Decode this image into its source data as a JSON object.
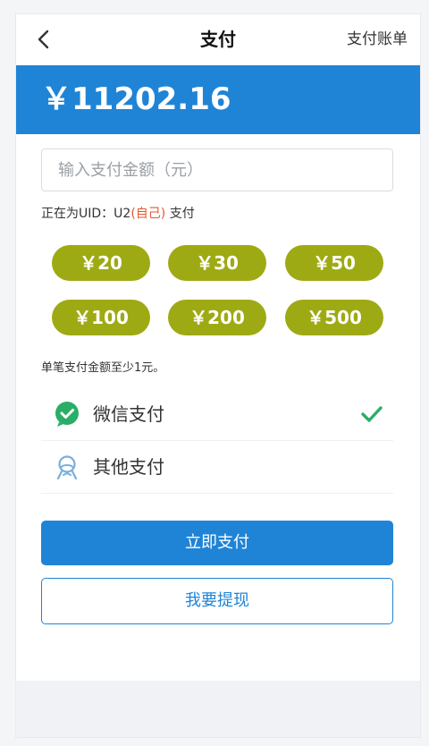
{
  "header": {
    "title": "支付",
    "right_link": "支付账单"
  },
  "balance": {
    "amount": "￥11202.16"
  },
  "amount_input": {
    "placeholder": "输入支付金额（元）",
    "value": ""
  },
  "uid_line": {
    "prefix": "正在为UID：U2",
    "self": "(自己)",
    "suffix": " 支付"
  },
  "presets": [
    "￥20",
    "￥30",
    "￥50",
    "￥100",
    "￥200",
    "￥500"
  ],
  "hint": "单笔支付金额至少1元。",
  "methods": [
    {
      "label": "微信支付",
      "icon": "wechat-pay-icon",
      "selected": true
    },
    {
      "label": "其他支付",
      "icon": "other-pay-icon",
      "selected": false
    }
  ],
  "actions": {
    "pay_now": "立即支付",
    "withdraw": "我要提现"
  },
  "colors": {
    "primary": "#1f84d6",
    "chip": "#9eaa13",
    "wechat": "#2aae67",
    "self": "#e4572e"
  }
}
